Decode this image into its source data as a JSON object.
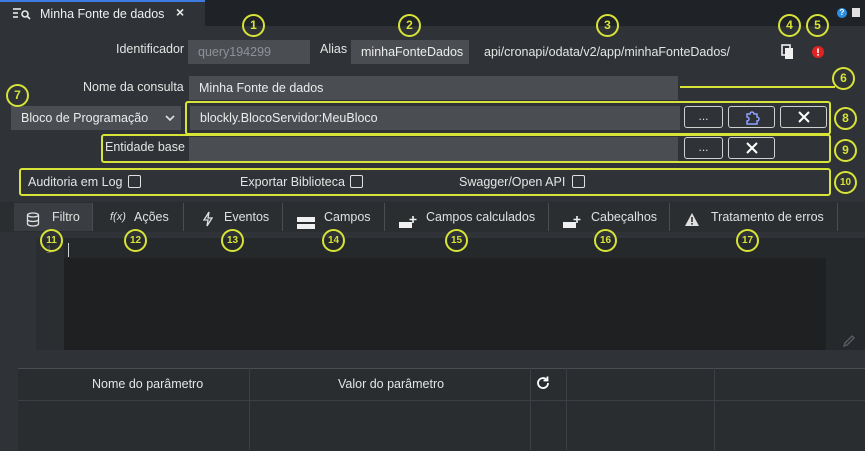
{
  "tab": {
    "title": "Minha Fonte de dados",
    "close": "×"
  },
  "window": {
    "help": "?"
  },
  "form": {
    "id_label": "Identificador",
    "id_value": "query194299",
    "alias_label": "Alias",
    "alias_value": "minhaFonteDados",
    "url": "api/cronapi/odata/v2/app/minhaFonteDados/",
    "query_name_label": "Nome da consulta",
    "query_name_value": "Minha Fonte de dados",
    "source_type": "Bloco de Programação",
    "block_value": "blockly.BlocoServidor:MeuBloco",
    "base_entity_label": "Entidade base",
    "base_entity_value": "",
    "btn_ellipsis": "...",
    "audit_label": "Auditoria em Log",
    "export_label": "Exportar Biblioteca",
    "swagger_label": "Swagger/Open API"
  },
  "sections": [
    {
      "label": "Filtro"
    },
    {
      "label": "Ações"
    },
    {
      "label": "Eventos"
    },
    {
      "label": "Campos"
    },
    {
      "label": "Campos calculados"
    },
    {
      "label": "Cabeçalhos"
    },
    {
      "label": "Tratamento de erros"
    }
  ],
  "editor": {
    "line_number": "1"
  },
  "params": {
    "col_name": "Nome do parâmetro",
    "col_value": "Valor do parâmetro"
  },
  "callouts": [
    "1",
    "2",
    "3",
    "4",
    "5",
    "6",
    "7",
    "8",
    "9",
    "10",
    "11",
    "12",
    "13",
    "14",
    "15",
    "16",
    "17"
  ],
  "colors": {
    "accent": "#d7e336",
    "tab_accent": "#3d7be0",
    "error": "#e02424"
  }
}
